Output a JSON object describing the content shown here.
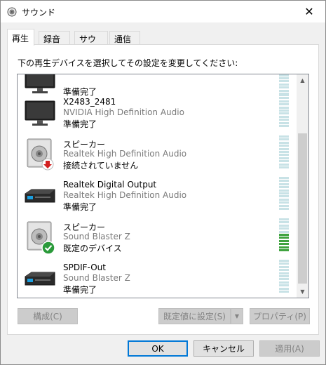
{
  "window": {
    "title": "サウンド",
    "close_symbol": "✕"
  },
  "tabs": [
    {
      "label": "再生",
      "active": true
    },
    {
      "label": "録音",
      "active": false
    },
    {
      "label": "サウンド",
      "active": false
    },
    {
      "label": "通信",
      "active": false
    }
  ],
  "instruction": "下の再生デバイスを選択してその設定を変更してください:",
  "devices": [
    {
      "name": "",
      "driver": "",
      "status": "準備完了",
      "icon": "monitor-icon",
      "badge": "",
      "meter_level": 0
    },
    {
      "name": "X2483_2481",
      "driver": "NVIDIA High Definition Audio",
      "status": "準備完了",
      "icon": "monitor-icon",
      "badge": "",
      "meter_level": 0
    },
    {
      "name": "スピーカー",
      "driver": "Realtek High Definition Audio",
      "status": "接続されていません",
      "icon": "speaker-icon",
      "badge": "red-down-arrow",
      "meter_level": 0
    },
    {
      "name": "Realtek Digital Output",
      "driver": "Realtek High Definition Audio",
      "status": "準備完了",
      "icon": "receiver-icon",
      "badge": "",
      "meter_level": 0
    },
    {
      "name": "スピーカー",
      "driver": "Sound Blaster Z",
      "status": "既定のデバイス",
      "icon": "speaker-icon",
      "badge": "green-check",
      "meter_level": 0.5
    },
    {
      "name": "SPDIF-Out",
      "driver": "Sound Blaster Z",
      "status": "準備完了",
      "icon": "receiver-icon",
      "badge": "",
      "meter_level": 0
    }
  ],
  "buttons": {
    "configure": "構成(C)",
    "set_default": "既定値に設定(S)",
    "properties": "プロパティ(P)",
    "ok": "OK",
    "cancel": "キャンセル",
    "apply": "適用(A)"
  },
  "colors": {
    "accent": "#0078d7",
    "meter_on": "#3fa33f",
    "meter_off": "#c8e2e6"
  }
}
